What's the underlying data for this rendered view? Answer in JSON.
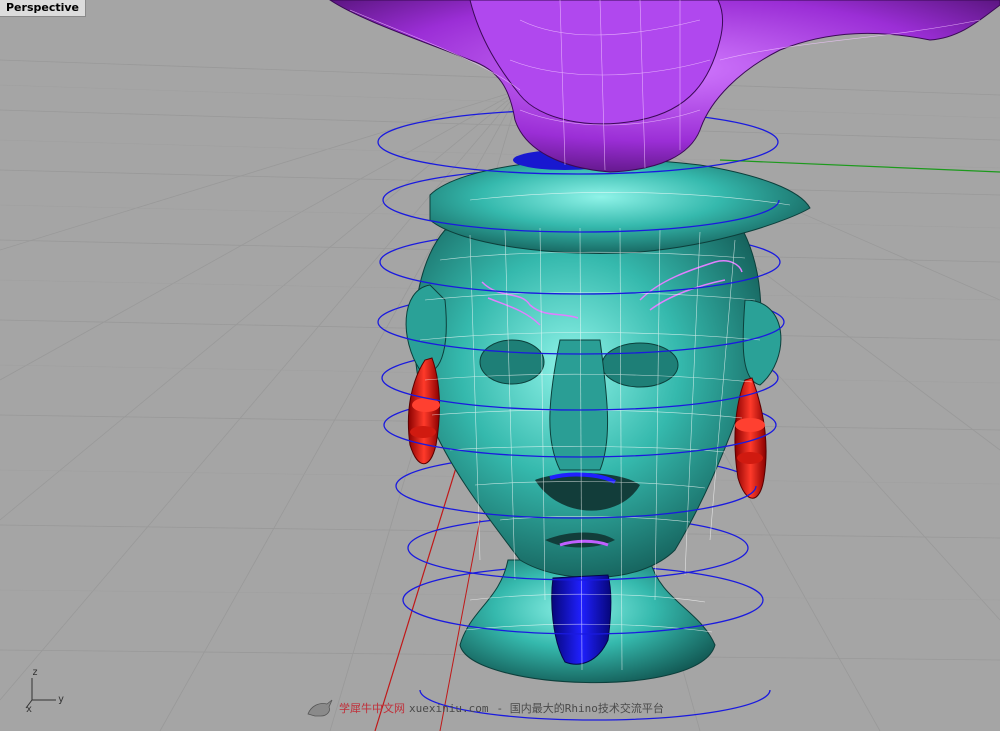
{
  "viewport": {
    "title": "Perspective"
  },
  "axis_indicator": {
    "z_label": "z",
    "x_label": "x",
    "y_label": "y"
  },
  "watermark": {
    "brand": "学犀牛中文网",
    "site": "xuexiniu.com",
    "tagline": "- 国内最大的Rhino技术交流平台"
  },
  "colors": {
    "background": "#a5a5a5",
    "grid": "#9a9a9a",
    "head_surface": "#3bb8ae",
    "isocurve": "#ffffff",
    "ring_curves": "#1a1adf",
    "top_sculpture": "#a030d8",
    "ear_ornaments": "#e01010",
    "tongue": "#1010c8",
    "axis_red": "#c01818",
    "axis_green": "#1c9a1c"
  }
}
